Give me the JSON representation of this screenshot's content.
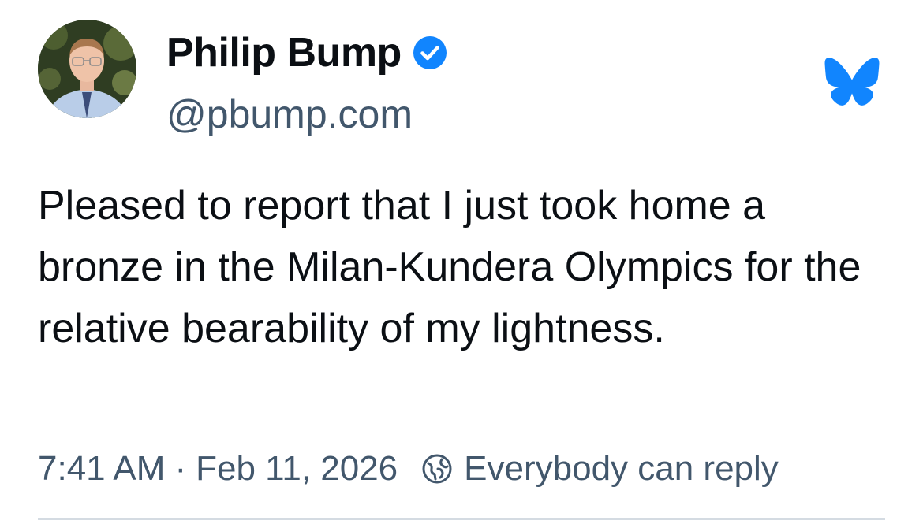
{
  "author": {
    "display_name": "Philip Bump",
    "handle": "@pbump.com",
    "verified": true,
    "avatar_icon": "avatar-photo"
  },
  "platform_logo": "bluesky-butterfly-icon",
  "post": {
    "text": "Pleased to report that I just took home a bronze in the Milan-Kundera Olympics for the relative bearability of my lightness."
  },
  "meta": {
    "time": "7:41 AM",
    "separator": "·",
    "date": "Feb 11, 2026",
    "reply_setting_icon": "globe-reply-icon",
    "reply_setting": "Everybody can reply"
  },
  "colors": {
    "text_primary": "#0b0f14",
    "text_secondary": "#42576c",
    "brand_blue": "#1185fe",
    "divider": "#d4dbe2"
  }
}
